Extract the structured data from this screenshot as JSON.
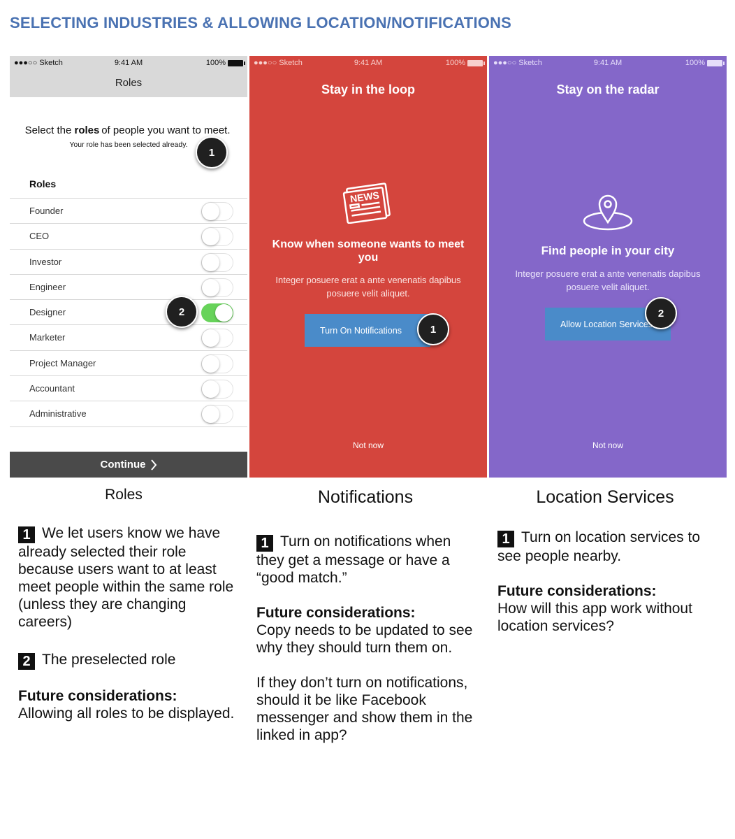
{
  "page_title": "SELECTING INDUSTRIES & ALLOWING LOCATION/NOTIFICATIONS",
  "status_bar": {
    "carrier": "●●●○○ Sketch",
    "time": "9:41 AM",
    "battery": "100%"
  },
  "roles_screen": {
    "nav_title": "Roles",
    "intro_pre": "Select the ",
    "intro_bold": "roles",
    "intro_post": " of people you want to meet.",
    "intro_small": "Your role has been selected already.",
    "heading": "Roles",
    "roles": [
      {
        "label": "Founder",
        "on": false
      },
      {
        "label": "CEO",
        "on": false
      },
      {
        "label": "Investor",
        "on": false
      },
      {
        "label": "Engineer",
        "on": false
      },
      {
        "label": "Designer",
        "on": true
      },
      {
        "label": "Marketer",
        "on": false
      },
      {
        "label": "Project Manager",
        "on": false
      },
      {
        "label": "Accountant",
        "on": false
      },
      {
        "label": "Administrative",
        "on": false
      }
    ],
    "continue_label": "Continue",
    "badge_1": "1",
    "badge_2": "2"
  },
  "notifications_screen": {
    "title": "Stay in the loop",
    "icon": "newspaper-icon",
    "icon_text": "NEWS",
    "heading": "Know when someone wants to meet you",
    "body": "Integer posuere erat a ante venenatis dapibus posuere velit aliquet.",
    "button_label": "Turn On Notifications",
    "not_now": "Not now",
    "badge": "1",
    "bg_color": "#d4453d"
  },
  "location_screen": {
    "title": "Stay on the radar",
    "icon": "map-pin-icon",
    "heading": "Find people in your city",
    "body": "Integer posuere erat a ante venenatis dapibus posuere velit aliquet.",
    "button_label": "Allow Location Services",
    "not_now": "Not now",
    "badge": "2",
    "bg_color": "#8467c9"
  },
  "captions": {
    "roles": "Roles",
    "notifications": "Notifications",
    "location": "Location Services"
  },
  "roles_notes": {
    "n1": "1",
    "t1": "We let users know we have already selected their role because users want to at least meet people within the same role (unless they are changing careers)",
    "n2": "2",
    "t2": "The preselected role",
    "future_heading": "Future considerations:",
    "future_text": "Allowing all roles to be displayed."
  },
  "notifications_notes": {
    "n1": "1",
    "t1": "Turn on notifications when they get a message or have a “good match.”",
    "future_heading": "Future considerations:",
    "future_text": "Copy needs to be updated to see why they should turn them on.",
    "extra_text": "If they don’t turn on notifications, should it be like Facebook messenger and show them in the linked in app?"
  },
  "location_notes": {
    "n1": "1",
    "t1": "Turn on location services to see people nearby.",
    "future_heading": "Future considerations:",
    "future_text": "How will this app work without location services?"
  }
}
